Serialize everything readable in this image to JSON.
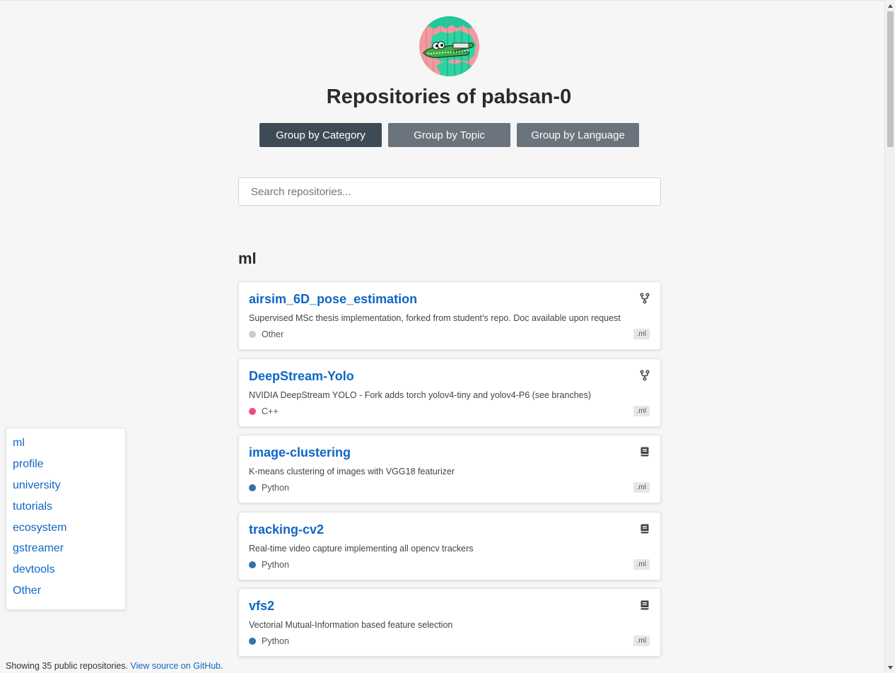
{
  "header": {
    "avatar_icon": "crocodile-avatar-icon",
    "title": "Repositories of pabsan-0"
  },
  "group_buttons": [
    {
      "label": "Group by Category",
      "active": true
    },
    {
      "label": "Group by Topic",
      "active": false
    },
    {
      "label": "Group by Language",
      "active": false
    }
  ],
  "search": {
    "placeholder": "Search repositories...",
    "value": ""
  },
  "section": {
    "title": "ml"
  },
  "repos": [
    {
      "name": "airsim_6D_pose_estimation",
      "icon": "fork-icon",
      "description": "Supervised MSc thesis implementation, forked from student’s repo. Doc available upon request",
      "language": "Other",
      "language_color": "#cccccc",
      "topic": ".ml"
    },
    {
      "name": "DeepStream-Yolo",
      "icon": "fork-icon",
      "description": "NVIDIA DeepStream YOLO - Fork adds torch yolov4-tiny and yolov4-P6 (see branches)",
      "language": "C++",
      "language_color": "#f34b7d",
      "topic": ".ml"
    },
    {
      "name": "image-clustering",
      "icon": "book-icon",
      "description": "K-means clustering of images with VGG18 featurizer",
      "language": "Python",
      "language_color": "#3572a5",
      "topic": ".ml"
    },
    {
      "name": "tracking-cv2",
      "icon": "book-icon",
      "description": "Real-time video capture implementing all opencv trackers",
      "language": "Python",
      "language_color": "#3572a5",
      "topic": ".ml"
    },
    {
      "name": "vfs2",
      "icon": "book-icon",
      "description": "Vectorial Mutual-Information based feature selection",
      "language": "Python",
      "language_color": "#3572a5",
      "topic": ".ml"
    }
  ],
  "sidebar": {
    "items": [
      "ml",
      "profile",
      "university",
      "tutorials",
      "ecosystem",
      "gstreamer",
      "devtools",
      "Other"
    ]
  },
  "footer": {
    "text": "Showing 35 public repositories.",
    "link_text": "View source on GitHub",
    "suffix": "."
  },
  "colors": {
    "link": "#0f67c4",
    "active_button": "#3f4a57",
    "inactive_button": "#6b737c"
  }
}
